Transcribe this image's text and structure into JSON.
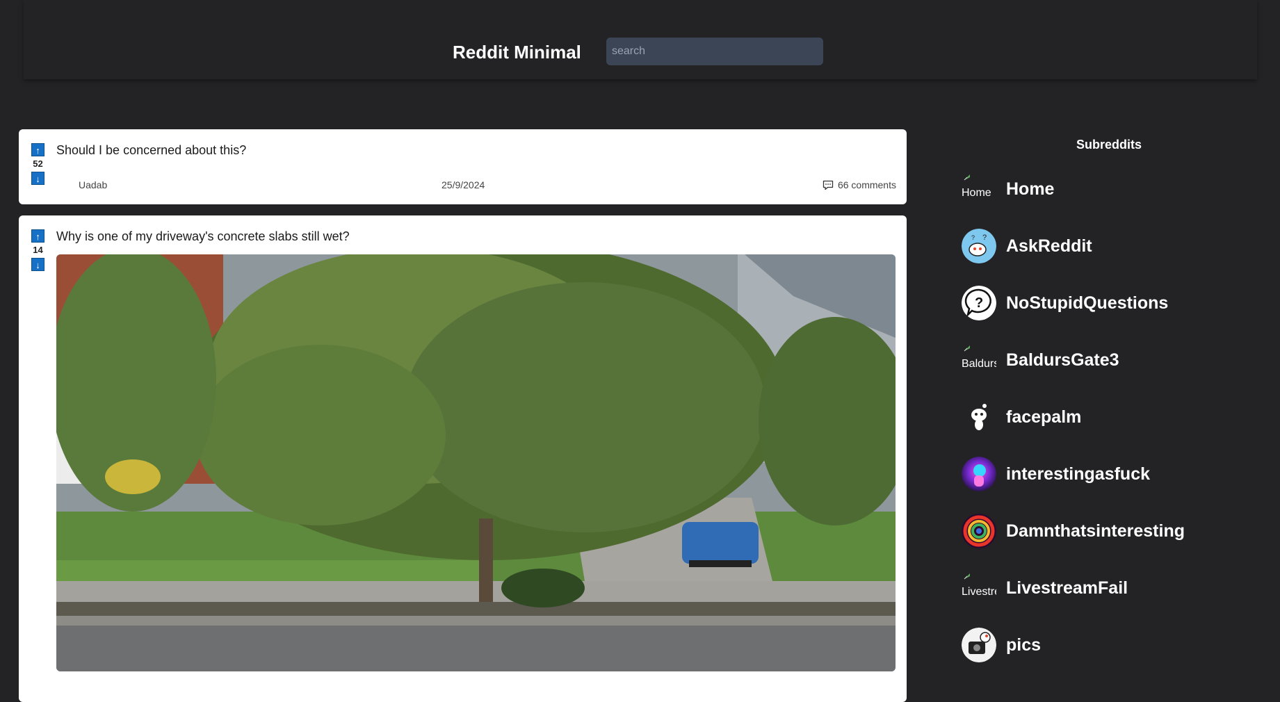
{
  "header": {
    "logo": "Reddit Minimal",
    "search_placeholder": "search"
  },
  "posts": [
    {
      "title": "Should I be concerned about this?",
      "votes": "52",
      "upvote_icon": "arrow-up-icon",
      "downvote_icon": "arrow-down-icon",
      "author": "Uadab",
      "date": "25/9/2024",
      "comments": "66 comments"
    },
    {
      "title": "Why is one of my driveway's concrete slabs still wet?",
      "votes": "14",
      "upvote_icon": "arrow-up-icon",
      "downvote_icon": "arrow-down-icon"
    }
  ],
  "sidebar": {
    "title": "Subreddits",
    "items": [
      {
        "label": "Home",
        "icon_alt": "Home",
        "icon": "broken-image-icon"
      },
      {
        "label": "AskReddit",
        "icon": "askreddit-icon"
      },
      {
        "label": "NoStupidQuestions",
        "icon": "question-mark-icon"
      },
      {
        "label": "BaldursGate3",
        "icon_alt": "Baldurs",
        "icon": "broken-image-icon"
      },
      {
        "label": "facepalm",
        "icon": "snoo-icon"
      },
      {
        "label": "interestingasfuck",
        "icon": "interestingasfuck-icon"
      },
      {
        "label": "Damnthatsinteresting",
        "icon": "swirl-icon"
      },
      {
        "label": "LivestreamFail",
        "icon_alt": "Livestre",
        "icon": "broken-image-icon"
      },
      {
        "label": "pics",
        "icon": "pics-icon"
      }
    ]
  },
  "colors": {
    "background": "#232325",
    "card": "#ffffff",
    "vote_button": "#1670c6",
    "search_bg": "#3c4555"
  }
}
